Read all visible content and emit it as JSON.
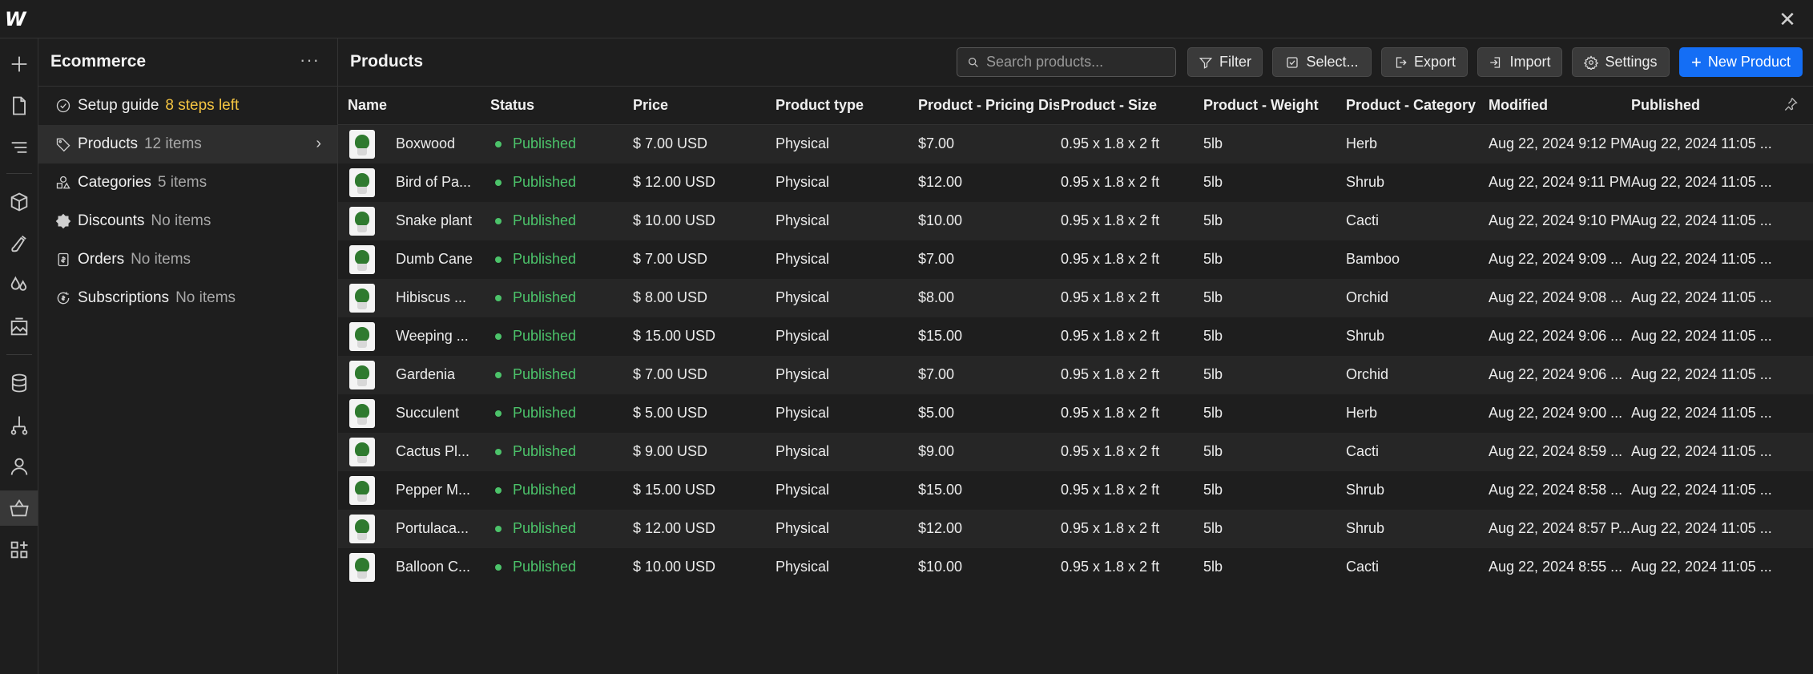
{
  "app": {
    "logo": "W",
    "close": "✕"
  },
  "rail": {
    "icons": [
      "plus-icon",
      "page-icon",
      "navigator-icon",
      "box-icon",
      "style-icon",
      "drops-icon",
      "image-icon",
      "database-icon",
      "flow-icon",
      "user-icon",
      "basket-icon",
      "apps-icon"
    ]
  },
  "sidebar": {
    "title": "Ecommerce",
    "more": "···",
    "items": [
      {
        "label": "Setup guide",
        "sub": "8 steps left",
        "icon": "check-circle-icon",
        "accent": true
      },
      {
        "label": "Products",
        "sub": "12 items",
        "icon": "tag-icon",
        "active": true
      },
      {
        "label": "Categories",
        "sub": "5 items",
        "icon": "shapes-icon"
      },
      {
        "label": "Discounts",
        "sub": "No items",
        "icon": "discount-badge-icon"
      },
      {
        "label": "Orders",
        "sub": "No items",
        "icon": "receipt-icon"
      },
      {
        "label": "Subscriptions",
        "sub": "No items",
        "icon": "dollar-cycle-icon"
      }
    ]
  },
  "main": {
    "title": "Products",
    "search_placeholder": "Search products...",
    "buttons": {
      "filter": "Filter",
      "select": "Select...",
      "export": "Export",
      "import": "Import",
      "settings": "Settings",
      "new_product": "New Product"
    }
  },
  "table": {
    "columns": [
      "Name",
      "Status",
      "Price",
      "Product type",
      "Product - Pricing Display",
      "Product - Size",
      "Product - Weight",
      "Product - Category",
      "Modified",
      "Published"
    ],
    "rows": [
      [
        "Boxwood",
        "Published",
        "$ 7.00 USD",
        "Physical",
        "$7.00",
        "0.95 x 1.8 x 2 ft",
        "5lb",
        "Herb",
        "Aug 22, 2024 9:12 PM",
        "Aug 22, 2024 11:05 ..."
      ],
      [
        "Bird of Pa...",
        "Published",
        "$ 12.00 USD",
        "Physical",
        "$12.00",
        "0.95 x 1.8 x 2 ft",
        "5lb",
        "Shrub",
        "Aug 22, 2024 9:11 PM",
        "Aug 22, 2024 11:05 ..."
      ],
      [
        "Snake plant",
        "Published",
        "$ 10.00 USD",
        "Physical",
        "$10.00",
        "0.95 x 1.8 x 2 ft",
        "5lb",
        "Cacti",
        "Aug 22, 2024 9:10 PM",
        "Aug 22, 2024 11:05 ..."
      ],
      [
        "Dumb Cane",
        "Published",
        "$ 7.00 USD",
        "Physical",
        "$7.00",
        "0.95 x 1.8 x 2 ft",
        "5lb",
        "Bamboo",
        "Aug 22, 2024 9:09 ...",
        "Aug 22, 2024 11:05 ..."
      ],
      [
        "Hibiscus ...",
        "Published",
        "$ 8.00 USD",
        "Physical",
        "$8.00",
        "0.95 x 1.8 x 2 ft",
        "5lb",
        "Orchid",
        "Aug 22, 2024 9:08 ...",
        "Aug 22, 2024 11:05 ..."
      ],
      [
        "Weeping ...",
        "Published",
        "$ 15.00 USD",
        "Physical",
        "$15.00",
        "0.95 x 1.8 x 2 ft",
        "5lb",
        "Shrub",
        "Aug 22, 2024 9:06 ...",
        "Aug 22, 2024 11:05 ..."
      ],
      [
        "Gardenia",
        "Published",
        "$ 7.00 USD",
        "Physical",
        "$7.00",
        "0.95 x 1.8 x 2 ft",
        "5lb",
        "Orchid",
        "Aug 22, 2024 9:06 ...",
        "Aug 22, 2024 11:05 ..."
      ],
      [
        "Succulent",
        "Published",
        "$ 5.00 USD",
        "Physical",
        "$5.00",
        "0.95 x 1.8 x 2 ft",
        "5lb",
        "Herb",
        "Aug 22, 2024 9:00 ...",
        "Aug 22, 2024 11:05 ..."
      ],
      [
        "Cactus Pl...",
        "Published",
        "$ 9.00 USD",
        "Physical",
        "$9.00",
        "0.95 x 1.8 x 2 ft",
        "5lb",
        "Cacti",
        "Aug 22, 2024 8:59 ...",
        "Aug 22, 2024 11:05 ..."
      ],
      [
        "Pepper M...",
        "Published",
        "$ 15.00 USD",
        "Physical",
        "$15.00",
        "0.95 x 1.8 x 2 ft",
        "5lb",
        "Shrub",
        "Aug 22, 2024 8:58 ...",
        "Aug 22, 2024 11:05 ..."
      ],
      [
        "Portulaca...",
        "Published",
        "$ 12.00 USD",
        "Physical",
        "$12.00",
        "0.95 x 1.8 x 2 ft",
        "5lb",
        "Shrub",
        "Aug 22, 2024 8:57 P...",
        "Aug 22, 2024 11:05 ..."
      ],
      [
        "Balloon C...",
        "Published",
        "$ 10.00 USD",
        "Physical",
        "$10.00",
        "0.95 x 1.8 x 2 ft",
        "5lb",
        "Cacti",
        "Aug 22, 2024 8:55 ...",
        "Aug 22, 2024 11:05 ..."
      ]
    ]
  },
  "colors": {
    "accent": "#146ef5",
    "published": "#4cc36a",
    "setup_accent": "#f5c542"
  }
}
